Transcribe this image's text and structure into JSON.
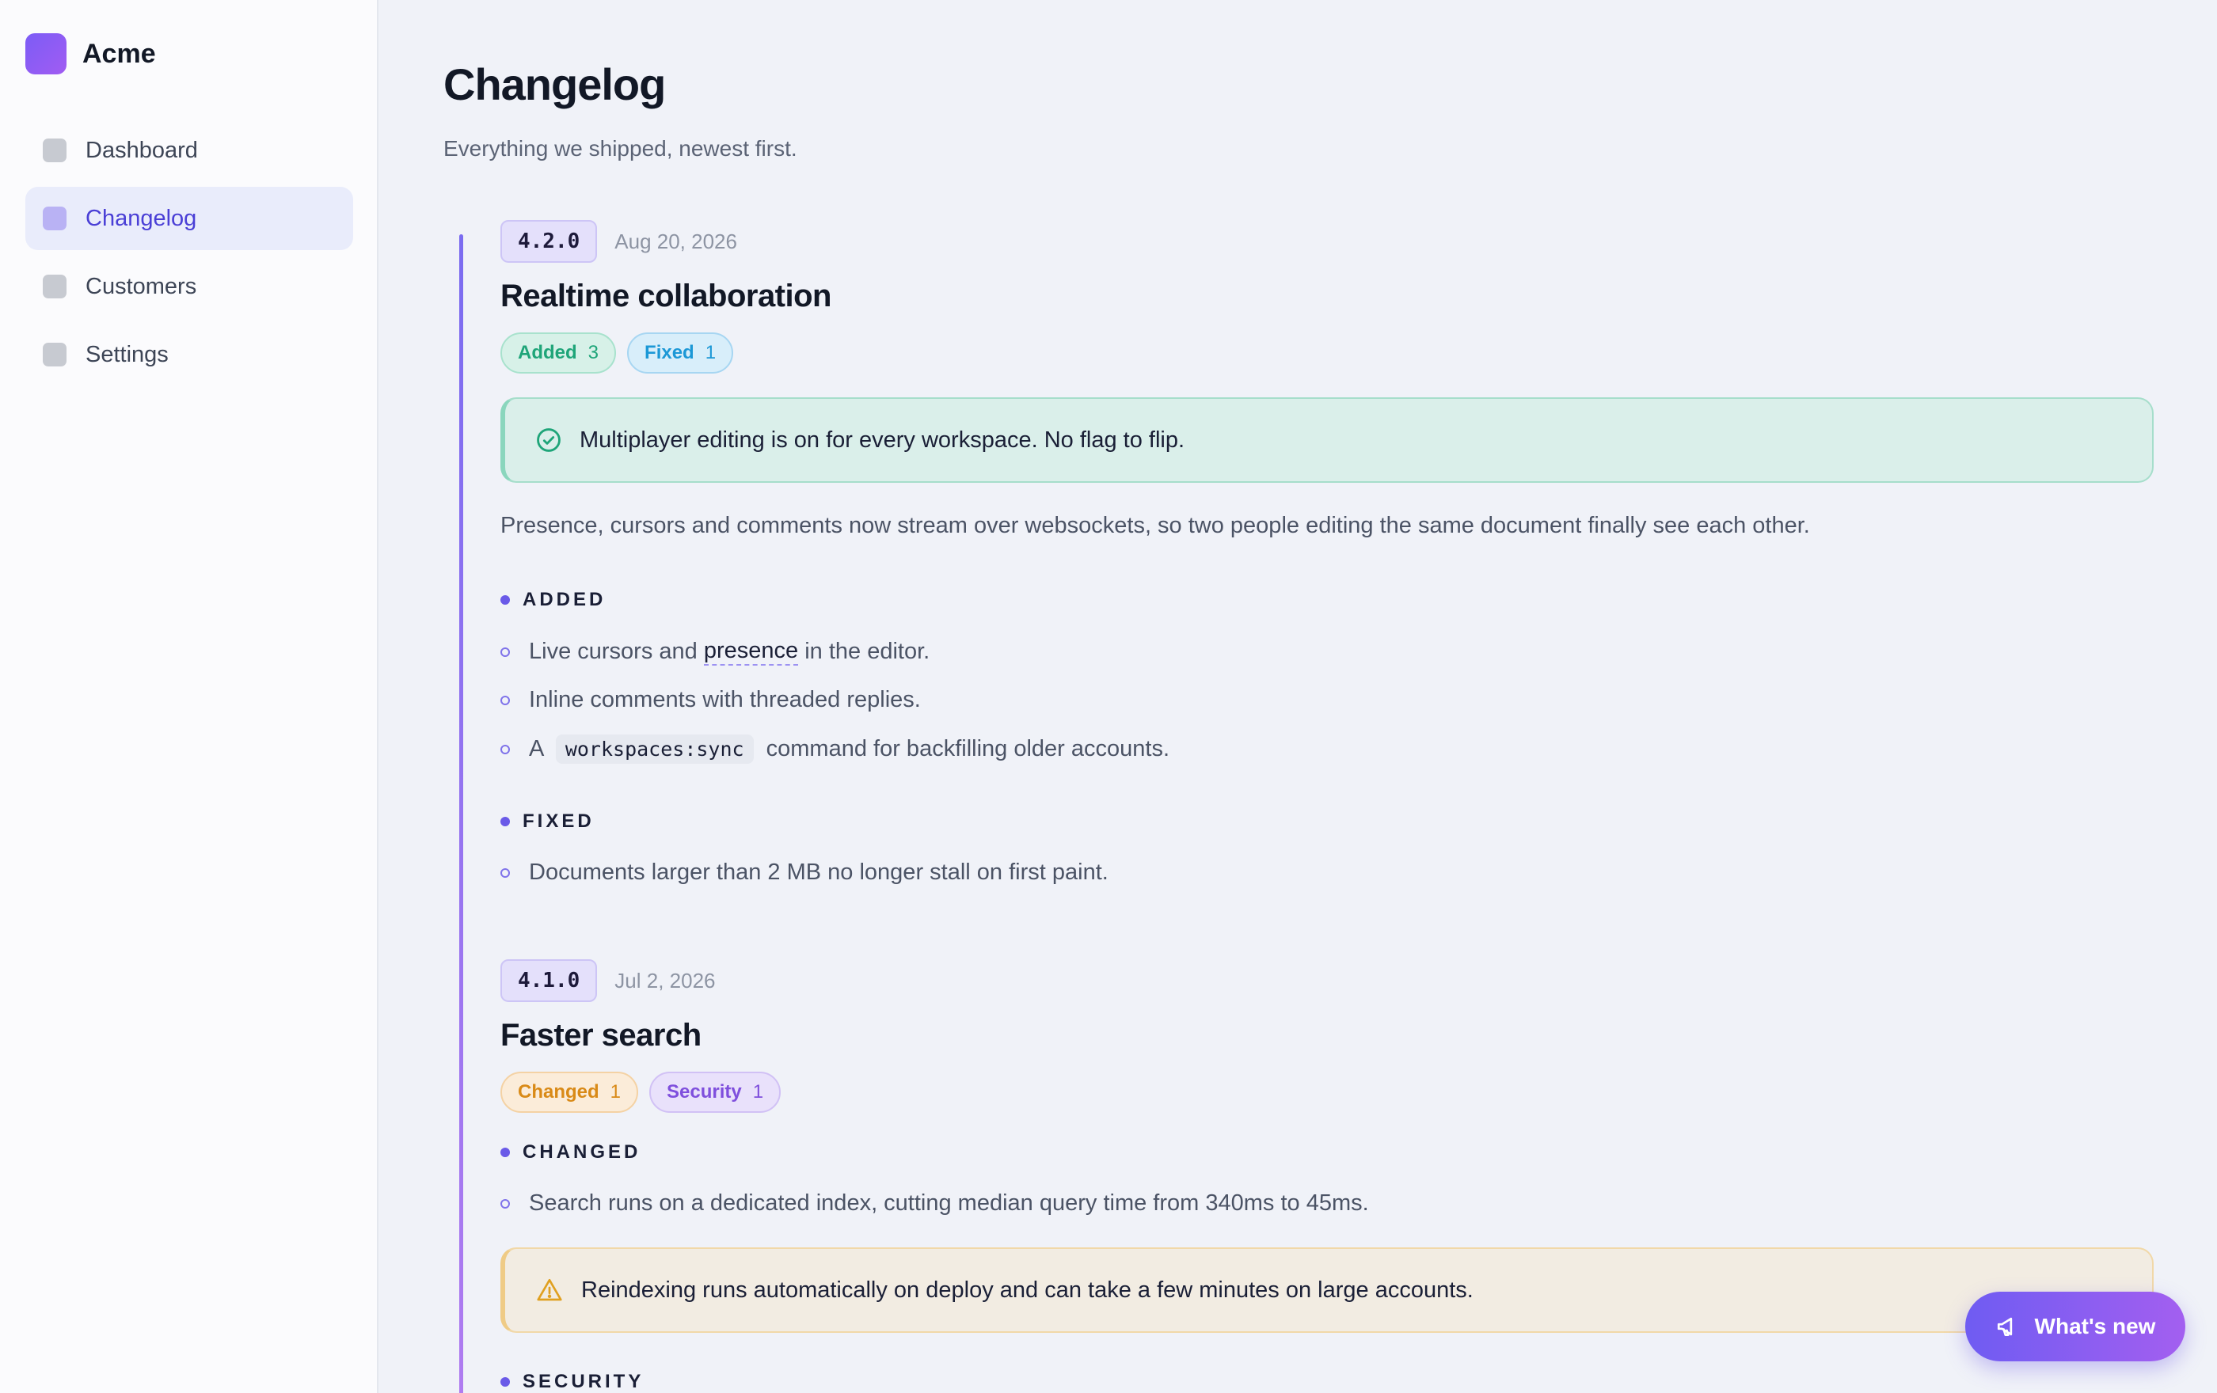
{
  "brand": {
    "name": "Acme"
  },
  "nav": {
    "items": [
      {
        "label": "Dashboard",
        "active": false
      },
      {
        "label": "Changelog",
        "active": true
      },
      {
        "label": "Customers",
        "active": false
      },
      {
        "label": "Settings",
        "active": false
      }
    ]
  },
  "page": {
    "title": "Changelog",
    "subtitle": "Everything we shipped, newest first."
  },
  "releases": [
    {
      "version": "4.2.0",
      "date": "Aug 20, 2026",
      "title": "Realtime collaboration",
      "chips": [
        {
          "label": "Added",
          "count": "3",
          "kind": "added"
        },
        {
          "label": "Fixed",
          "count": "1",
          "kind": "fixed"
        }
      ],
      "callout": {
        "kind": "success",
        "icon": "check-circle-icon",
        "text": "Multiplayer editing is on for every workspace. No flag to flip."
      },
      "description": "Presence, cursors and comments now stream over websockets, so two people editing the same document finally see each other.",
      "sections": [
        {
          "heading": "ADDED",
          "items": [
            {
              "pre": "Live cursors and ",
              "highlight": "presence",
              "post": " in the editor."
            },
            {
              "text": "Inline comments with threaded replies."
            },
            {
              "pre": "A ",
              "code": "workspaces:sync",
              "post": " command for backfilling older accounts."
            }
          ]
        },
        {
          "heading": "FIXED",
          "items": [
            {
              "text": "Documents larger than 2 MB no longer stall on first paint."
            }
          ]
        }
      ]
    },
    {
      "version": "4.1.0",
      "date": "Jul 2, 2026",
      "title": "Faster search",
      "chips": [
        {
          "label": "Changed",
          "count": "1",
          "kind": "changed"
        },
        {
          "label": "Security",
          "count": "1",
          "kind": "security"
        }
      ],
      "sections": [
        {
          "heading": "CHANGED",
          "items": [
            {
              "text": "Search runs on a dedicated index, cutting median query time from 340ms to 45ms."
            }
          ]
        },
        {
          "heading": "SECURITY",
          "items": []
        }
      ],
      "callout": {
        "kind": "warn",
        "icon": "warning-triangle-icon",
        "text": "Reindexing runs automatically on deploy and can take a few minutes on large accounts."
      }
    }
  ],
  "fab": {
    "label": "What's new",
    "icon": "megaphone-icon"
  },
  "colors": {
    "accent": "#6a5ae8",
    "added": "#1fa579",
    "fixed": "#1c98d6",
    "changed": "#d98a17",
    "security": "#7f4fdd"
  }
}
